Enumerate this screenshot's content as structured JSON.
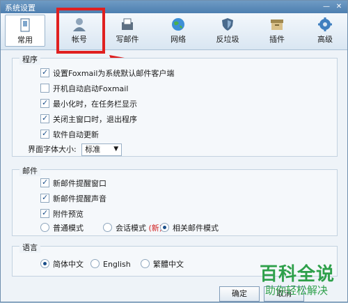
{
  "window": {
    "title": "系统设置"
  },
  "toolbar": {
    "items": [
      {
        "label": "常用",
        "icon": "document-icon"
      },
      {
        "label": "帐号",
        "icon": "user-icon"
      },
      {
        "label": "写邮件",
        "icon": "compose-icon"
      },
      {
        "label": "网络",
        "icon": "globe-icon"
      },
      {
        "label": "反垃圾",
        "icon": "shield-icon"
      },
      {
        "label": "插件",
        "icon": "plugin-box-icon"
      },
      {
        "label": "高级",
        "icon": "gear-icon"
      }
    ],
    "selected": "常用"
  },
  "program": {
    "title": "程序",
    "options": [
      {
        "label": "设置Foxmail为系统默认邮件客户端",
        "checked": true
      },
      {
        "label": "开机自动启动Foxmail",
        "checked": false
      },
      {
        "label": "最小化时，在任务栏显示",
        "checked": true
      },
      {
        "label": "关闭主窗口时，退出程序",
        "checked": true
      },
      {
        "label": "软件自动更新",
        "checked": true
      }
    ],
    "font_size_label": "界面字体大小:",
    "font_size_value": "标准"
  },
  "mail": {
    "title": "邮件",
    "options": [
      {
        "label": "新邮件提醒窗口",
        "checked": true
      },
      {
        "label": "新邮件提醒声音",
        "checked": true
      },
      {
        "label": "附件预览",
        "checked": true
      }
    ],
    "modes": [
      {
        "label": "普通模式",
        "selected": false
      },
      {
        "label": "会话模式",
        "selected": false,
        "tag": "(新)"
      },
      {
        "label": "相关邮件模式",
        "selected": true
      }
    ]
  },
  "language": {
    "title": "语言",
    "options": [
      {
        "label": "简体中文",
        "selected": true
      },
      {
        "label": "English",
        "selected": false
      },
      {
        "label": "繁體中文",
        "selected": false
      }
    ]
  },
  "buttons": {
    "ok": "确定",
    "cancel": "取消"
  },
  "watermark": {
    "line1": "百科全说",
    "line2": "助你轻松解决"
  },
  "colors": {
    "highlight": "#e02020",
    "watermark": "#2ea04a",
    "accent": "#1b4f8a"
  }
}
